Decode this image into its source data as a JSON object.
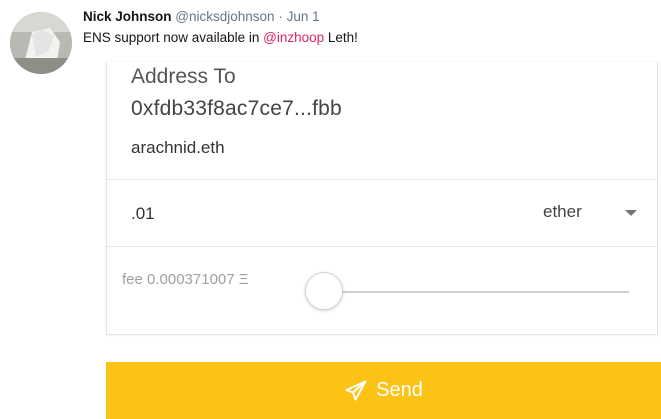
{
  "tweet": {
    "author_name": "Nick Johnson",
    "handle": "@nicksdjohnson",
    "separator": "·",
    "date": "Jun 1",
    "text_before": "ENS support now available in ",
    "mention": "@inzhoop",
    "text_after": " Leth!",
    "mention_color": "#e0245e"
  },
  "form": {
    "address_label": "Address To",
    "address_value": "0xfdb33f8ac7ce7...fbb",
    "ens_name": "arachnid.eth",
    "amount": ".01",
    "unit": "ether",
    "fee_label": "fee 0.000371007 Ξ",
    "fee_slider_position": 0
  },
  "send_button": {
    "label": "Send",
    "icon": "paper-plane-icon",
    "color": "#fbc316"
  }
}
